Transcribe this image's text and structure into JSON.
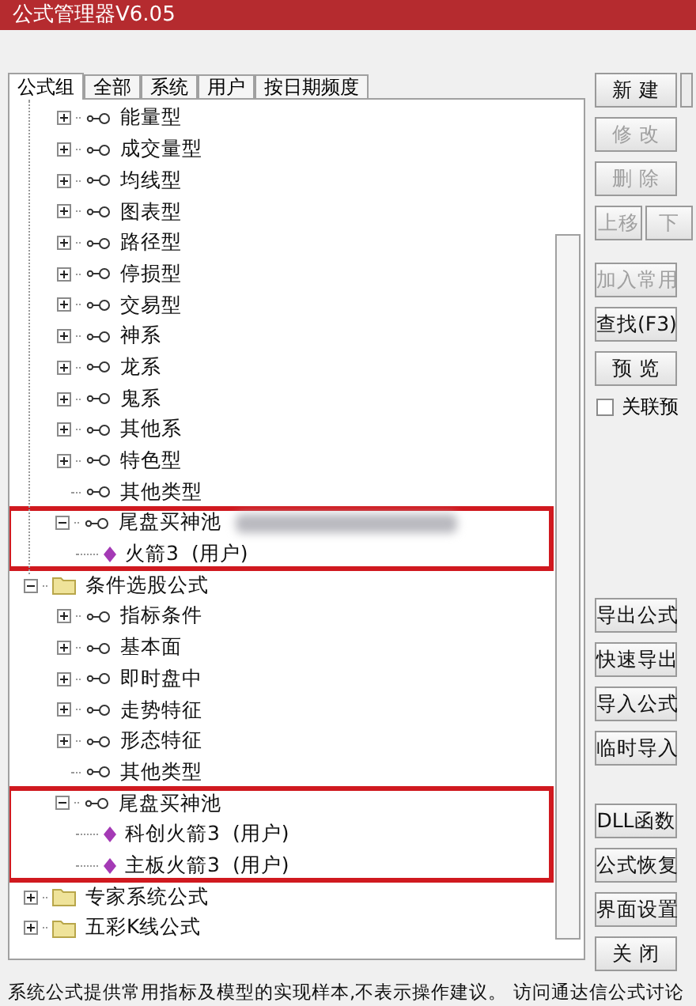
{
  "window": {
    "title": "公式管理器V6.05"
  },
  "tabs": [
    {
      "label": "公式组",
      "selected": true
    },
    {
      "label": "全部",
      "selected": false
    },
    {
      "label": "系统",
      "selected": false
    },
    {
      "label": "用户",
      "selected": false
    },
    {
      "label": "按日期频度",
      "selected": false
    }
  ],
  "tree": [
    {
      "kind": "continued",
      "children": [
        {
          "kind": "group",
          "label": "能量型",
          "expanded": false,
          "highlighted": false
        },
        {
          "kind": "group",
          "label": "成交量型",
          "expanded": false,
          "highlighted": false
        },
        {
          "kind": "group",
          "label": "均线型",
          "expanded": false,
          "highlighted": false
        },
        {
          "kind": "group",
          "label": "图表型",
          "expanded": false,
          "highlighted": false
        },
        {
          "kind": "group",
          "label": "路径型",
          "expanded": false,
          "highlighted": false
        },
        {
          "kind": "group",
          "label": "停损型",
          "expanded": false,
          "highlighted": false
        },
        {
          "kind": "group",
          "label": "交易型",
          "expanded": false,
          "highlighted": false
        },
        {
          "kind": "group",
          "label": "神系",
          "expanded": false,
          "highlighted": false
        },
        {
          "kind": "group",
          "label": "龙系",
          "expanded": false,
          "highlighted": false
        },
        {
          "kind": "group",
          "label": "鬼系",
          "expanded": false,
          "highlighted": false
        },
        {
          "kind": "group",
          "label": "其他系",
          "expanded": false,
          "highlighted": false
        },
        {
          "kind": "group",
          "label": "特色型",
          "expanded": false,
          "highlighted": false
        },
        {
          "kind": "leaf-group",
          "label": "其他类型"
        },
        {
          "kind": "group",
          "label": "尾盘买神池",
          "expanded": true,
          "highlighted": true,
          "blurred": true,
          "children": [
            {
              "kind": "formula",
              "label": "火箭3",
              "note": "(用户)"
            }
          ]
        }
      ]
    },
    {
      "kind": "folder",
      "label": "条件选股公式",
      "expanded": true,
      "highlighted": false,
      "children": [
        {
          "kind": "group",
          "label": "指标条件",
          "expanded": false,
          "highlighted": false
        },
        {
          "kind": "group",
          "label": "基本面",
          "expanded": false,
          "highlighted": false
        },
        {
          "kind": "group",
          "label": "即时盘中",
          "expanded": false,
          "highlighted": false
        },
        {
          "kind": "group",
          "label": "走势特征",
          "expanded": false,
          "highlighted": false
        },
        {
          "kind": "group",
          "label": "形态特征",
          "expanded": false,
          "highlighted": false
        },
        {
          "kind": "leaf-group",
          "label": "其他类型"
        },
        {
          "kind": "group",
          "label": "尾盘买神池",
          "expanded": true,
          "highlighted": true,
          "blurred": false,
          "children": [
            {
              "kind": "formula",
              "label": "科创火箭3",
              "note": "(用户)"
            },
            {
              "kind": "formula",
              "label": "主板火箭3",
              "note": "(用户)"
            }
          ]
        }
      ]
    },
    {
      "kind": "folder",
      "label": "专家系统公式",
      "expanded": false,
      "highlighted": false
    },
    {
      "kind": "folder",
      "label": "五彩K线公式",
      "expanded": false,
      "highlighted": false
    }
  ],
  "buttons_top": [
    {
      "label": "新 建",
      "disabled": false
    },
    {
      "label": "修 改",
      "disabled": true
    },
    {
      "label": "删 除",
      "disabled": true
    }
  ],
  "move_buttons": [
    {
      "label": "上移",
      "disabled": true
    },
    {
      "label": "下",
      "disabled": true
    }
  ],
  "buttons_mid": [
    {
      "label": "加入常用",
      "disabled": true
    },
    {
      "label": "查找(F3)",
      "disabled": false
    },
    {
      "label": "预 览",
      "disabled": false
    }
  ],
  "preview_checkbox": {
    "label": "关联预",
    "checked": false
  },
  "buttons_io": [
    {
      "label": "导出公式",
      "disabled": false
    },
    {
      "label": "快速导出",
      "disabled": false
    },
    {
      "label": "导入公式",
      "disabled": false
    },
    {
      "label": "临时导入",
      "disabled": false
    }
  ],
  "buttons_bottom": [
    {
      "label": "DLL函数",
      "disabled": false
    },
    {
      "label": "公式恢复",
      "disabled": false
    },
    {
      "label": "界面设置",
      "disabled": false
    },
    {
      "label": "关 闭",
      "disabled": false
    }
  ],
  "status_bar": "系统公式提供常用指标及模型的实现样本,不表示操作建议。 访问通达信公式讨论"
}
